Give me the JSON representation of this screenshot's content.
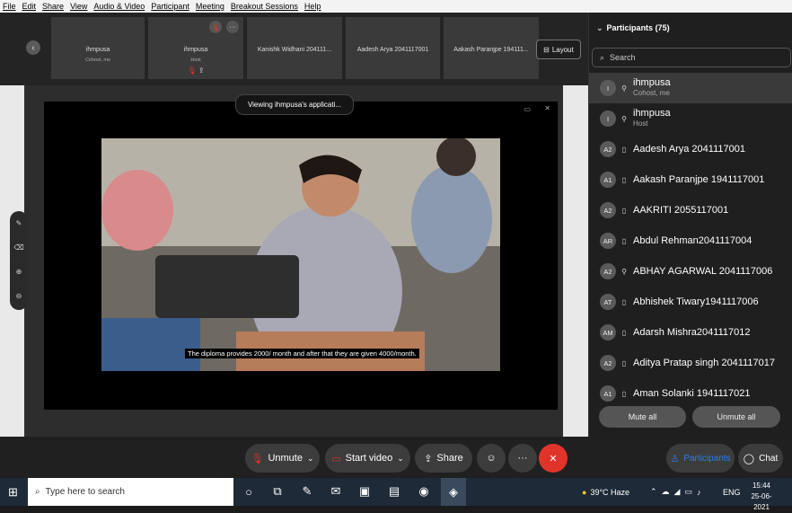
{
  "menu": [
    "File",
    "Edit",
    "Share",
    "View",
    "Audio & Video",
    "Participant",
    "Meeting",
    "Breakout Sessions",
    "Help"
  ],
  "tiles": [
    {
      "name": "ihmpusa",
      "sub": "Cohost, me"
    },
    {
      "name": "ihmpusa",
      "sub": "Host"
    },
    {
      "name": "Kanishk Widhani 204111...",
      "sub": ""
    },
    {
      "name": "Aadesh Arya 2041117001",
      "sub": ""
    },
    {
      "name": "Aakash Paranjpe 194111...",
      "sub": ""
    }
  ],
  "layout_label": "Layout",
  "viewing_text": "Viewing ihmpusa's applicati...",
  "video_caption": "The diploma provides 2000/ month and after that they are given 4000/month.",
  "participants": {
    "title": "Participants (75)",
    "search_placeholder": "Search",
    "list": [
      {
        "initials": "I",
        "name": "ihmpusa",
        "role": "Cohost, me",
        "icon": "mic-icon"
      },
      {
        "initials": "I",
        "name": "ihmpusa",
        "role": "Host",
        "icon": "mic-icon"
      },
      {
        "initials": "A2",
        "name": "Aadesh Arya 2041117001",
        "role": "",
        "icon": "device-icon"
      },
      {
        "initials": "A1",
        "name": "Aakash Paranjpe 1941117001",
        "role": "",
        "icon": "device-icon"
      },
      {
        "initials": "A2",
        "name": "AAKRITI 2055117001",
        "role": "",
        "icon": "device-icon"
      },
      {
        "initials": "AR",
        "name": "Abdul Rehman2041117004",
        "role": "",
        "icon": "device-icon"
      },
      {
        "initials": "A2",
        "name": "ABHAY AGARWAL 2041117006",
        "role": "",
        "icon": "mic-icon"
      },
      {
        "initials": "AT",
        "name": "Abhishek Tiwary1941117006",
        "role": "",
        "icon": "device-icon"
      },
      {
        "initials": "AM",
        "name": "Adarsh Mishra2041117012",
        "role": "",
        "icon": "device-icon"
      },
      {
        "initials": "A2",
        "name": "Aditya Pratap singh 2041117017",
        "role": "",
        "icon": "device-icon"
      },
      {
        "initials": "A1",
        "name": "Aman Solanki 1941117021",
        "role": "",
        "icon": "device-icon"
      }
    ],
    "mute_all": "Mute all",
    "unmute_all": "Unmute all"
  },
  "controls": {
    "unmute": "Unmute",
    "start_video": "Start video",
    "share": "Share",
    "more": "···",
    "participants": "Participants",
    "chat": "Chat"
  },
  "taskbar": {
    "search_placeholder": "Type here to search",
    "weather": "39°C  Haze",
    "lang": "ENG",
    "time": "15:44",
    "date": "25-06-2021"
  },
  "colors": {
    "accent": "#2f7de1",
    "end": "#e0342b",
    "unmute_red": "#e0342b"
  }
}
